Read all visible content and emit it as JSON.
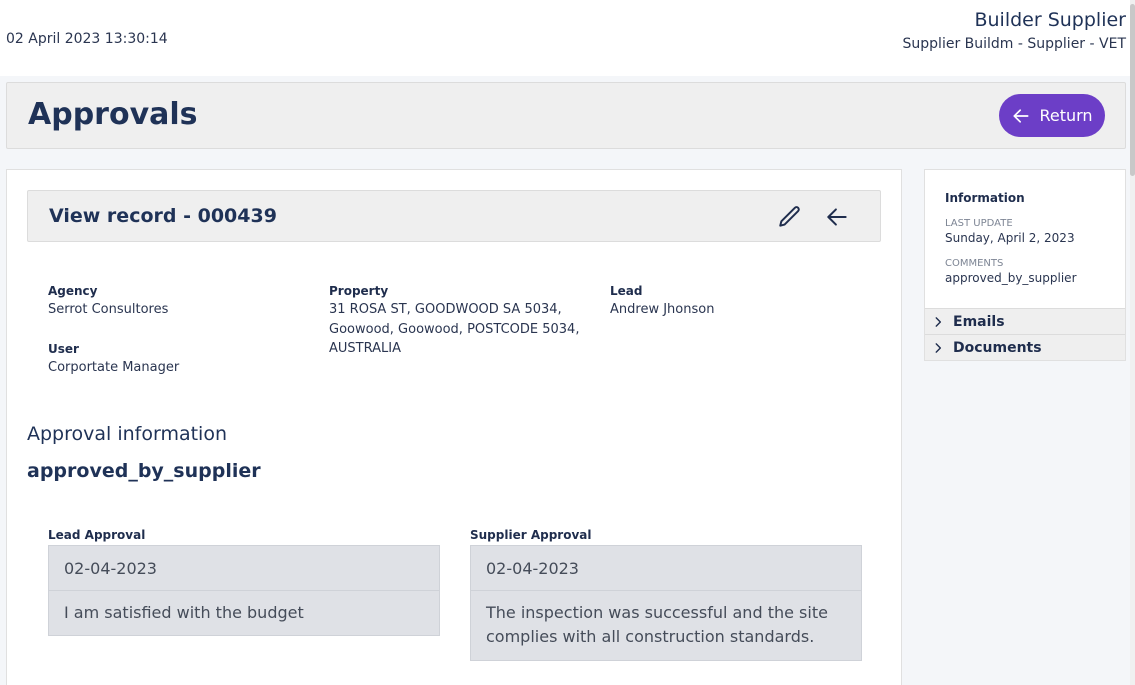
{
  "header": {
    "datetime": "02 April 2023 13:30:14",
    "company_name": "Builder Supplier",
    "company_sub": "Supplier Buildm - Supplier - VET"
  },
  "page": {
    "title": "Approvals",
    "return_label": "Return"
  },
  "record": {
    "title": "View record - 000439",
    "fields": {
      "agency_label": "Agency",
      "agency_value": "Serrot Consultores",
      "property_label": "Property",
      "property_line1": "31 ROSA ST, GOODWOOD SA 5034,",
      "property_line2": "Goowood, Goowood, POSTCODE 5034,",
      "property_line3": "AUSTRALIA",
      "lead_label": "Lead",
      "lead_value": "Andrew Jhonson",
      "user_label": "User",
      "user_value": "Corportate Manager"
    }
  },
  "approval": {
    "section_title": "Approval information",
    "status": "approved_by_supplier",
    "lead_label": "Lead Approval",
    "lead_date": "02-04-2023",
    "lead_comment": "I am satisfied with the budget",
    "supplier_label": "Supplier Approval",
    "supplier_date": "02-04-2023",
    "supplier_comment_line1": "The inspection was successful and the site",
    "supplier_comment_line2": "complies with all construction standards."
  },
  "sidebar": {
    "info_title": "Information",
    "last_update_label": "LAST UPDATE",
    "last_update_value": "Sunday, April 2, 2023",
    "comments_label": "COMMENTS",
    "comments_value": "approved_by_supplier",
    "accordions": [
      {
        "label": "Emails"
      },
      {
        "label": "Documents"
      }
    ]
  },
  "colors": {
    "accent": "#6c3ec7",
    "heading": "#1f3257"
  },
  "icons": {
    "return": "arrow-left-icon",
    "edit": "pencil-icon",
    "back": "arrow-left-icon",
    "accordion": "chevron-right-icon"
  }
}
